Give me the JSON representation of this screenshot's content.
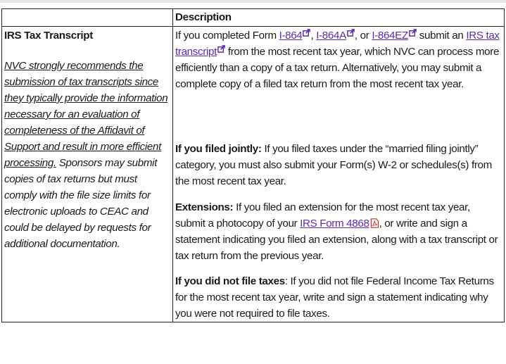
{
  "header": {
    "col1": "",
    "col2": "Description"
  },
  "row": {
    "title": "IRS Tax Transcript",
    "note_underlined": "NVC strongly recommends the submission of tax transcripts since they typically provide the information necessary for an evaluation of completeness of the Affidavit of Support and result in more efficient processing.",
    "note_rest": " Sponsors may submit copies of tax returns but must comply with the file size limits for electronic uploads to CEAC and could be delayed by requests for additional documentation."
  },
  "para1": {
    "t1": "If you completed Form ",
    "link1": "I-864",
    "t2": ", ",
    "link2": "I-864A",
    "t3": ", or ",
    "link3": "I-864EZ",
    "t4": " submit an ",
    "link4": "IRS tax transcript",
    "t5": " from the most recent tax year, which NVC can process more efficiently than a copy of a tax return. Alternatively, you may submit a complete copy of a filed tax return from the most recent tax year."
  },
  "para2": {
    "label": "If you filed jointly:",
    "text": " If you filed taxes under the “married filing jointly” category, you must also submit your Form(s) W-2 or schedules(s) from the most recent tax year."
  },
  "para3": {
    "label": "Extensions:",
    "t1": " If you filed an extension for the most recent tax year, submit a photocopy of your ",
    "link": "IRS Form 4868",
    "t2": ", or write and sign a statement indicating you filed an extension, along with a tax transcript or tax return from the previous year."
  },
  "para4": {
    "label": "If you did not file taxes",
    "text": ": If you did not file Federal Income Tax Returns for the most recent tax year, write and sign a statement indicating why you were not required to file taxes."
  },
  "colors": {
    "link": "#5b2ab5",
    "border": "#222222",
    "text": "#1a1a1a"
  },
  "icons": {
    "external": "external-link-icon",
    "pdf": "pdf-file-icon"
  }
}
